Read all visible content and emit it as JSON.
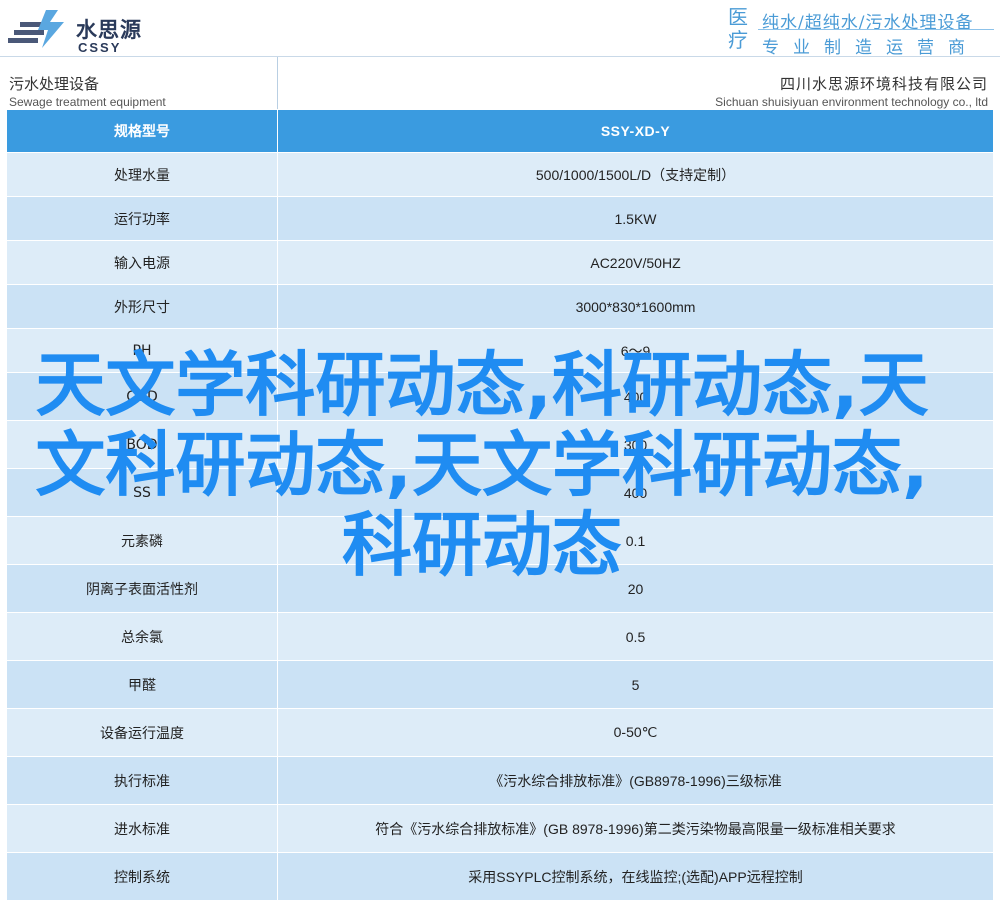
{
  "brand": {
    "name_cn": "水思源",
    "name_en": "CSSY",
    "tagline_side": [
      "医",
      "疗"
    ],
    "tagline_line1": "纯水/超纯水/污水处理设备",
    "tagline_line2": "专业制造运营商",
    "accent_color": "#4a9bd6",
    "logo_color": "#2a3a5a"
  },
  "heading": {
    "product_cn": "污水处理设备",
    "product_en": "Sewage treatment equipment",
    "company_cn": "四川水思源环境科技有限公司",
    "company_en": "Sichuan shuisiyuan environment technology co., ltd"
  },
  "table": {
    "header_color": "#3a9be0",
    "header": {
      "label": "规格型号",
      "value": "SSY-XD-Y"
    },
    "rows": [
      {
        "label": "处理水量",
        "value": "500/1000/1500L/D（支持定制）"
      },
      {
        "label": "运行功率",
        "value": "1.5KW"
      },
      {
        "label": "输入电源",
        "value": "AC220V/50HZ"
      },
      {
        "label": "外形尺寸",
        "value": "3000*830*1600mm"
      },
      {
        "label": "PH",
        "value": "6～9"
      },
      {
        "label": "COD",
        "value": "400"
      },
      {
        "label": "BOD",
        "value": "300"
      },
      {
        "label": "SS",
        "value": "400"
      },
      {
        "label": "元素磷",
        "value": "0.1"
      },
      {
        "label": "阴离子表面活性剂",
        "value": "20"
      },
      {
        "label": "总余氯",
        "value": "0.5"
      },
      {
        "label": "甲醛",
        "value": "5"
      },
      {
        "label": "设备运行温度",
        "value": "0-50℃"
      },
      {
        "label": "执行标准",
        "value": "《污水综合排放标准》(GB8978-1996)三级标准"
      },
      {
        "label": "进水标准",
        "value": "符合《污水综合排放标准》(GB 8978-1996)第二类污染物最高限量一级标准相关要求"
      },
      {
        "label": "控制系统",
        "value": "采用SSYPLC控制系统，在线监控;(选配)APP远程控制"
      }
    ]
  },
  "overlay": {
    "headline": "天文学科研动态,科研动态,天文科研动态,天文学科研动态,科研动态",
    "color": "#1f8cf2"
  }
}
